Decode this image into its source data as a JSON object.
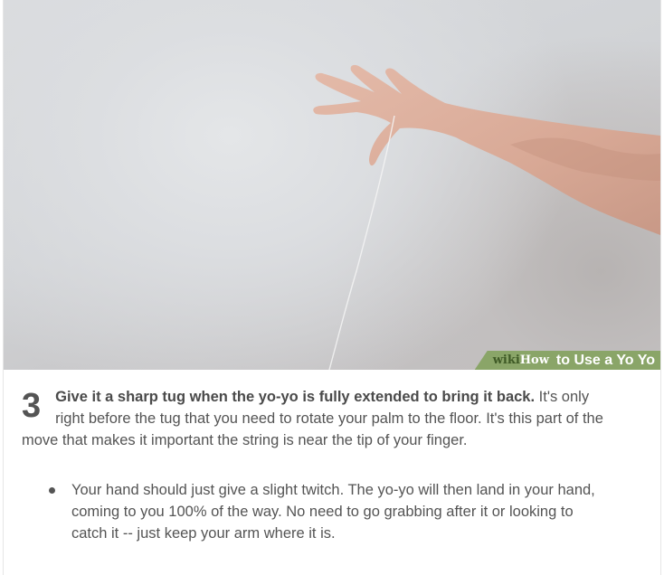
{
  "image": {
    "alt": "Hand releasing a yo-yo string"
  },
  "watermark": {
    "wiki": "wiki",
    "how": "How",
    "title": "to Use a Yo Yo"
  },
  "step": {
    "number": "3",
    "bold_text": "Give it a sharp tug when the yo-yo is fully extended to bring it back.",
    "body_text": " It's only right before the tug that you need to rotate your palm to the floor. It's this part of the move that makes it important the string is near the tip of your finger."
  },
  "bullets": [
    {
      "text": "Your hand should just give a slight twitch. The yo-yo will then land in your hand, coming to you 100% of the way. No need to go grabbing after it or looking to catch it -- just keep your arm where it is."
    }
  ],
  "colors": {
    "watermark_bg": "#8aa568",
    "text": "#545454",
    "skin": "#d9a793"
  }
}
